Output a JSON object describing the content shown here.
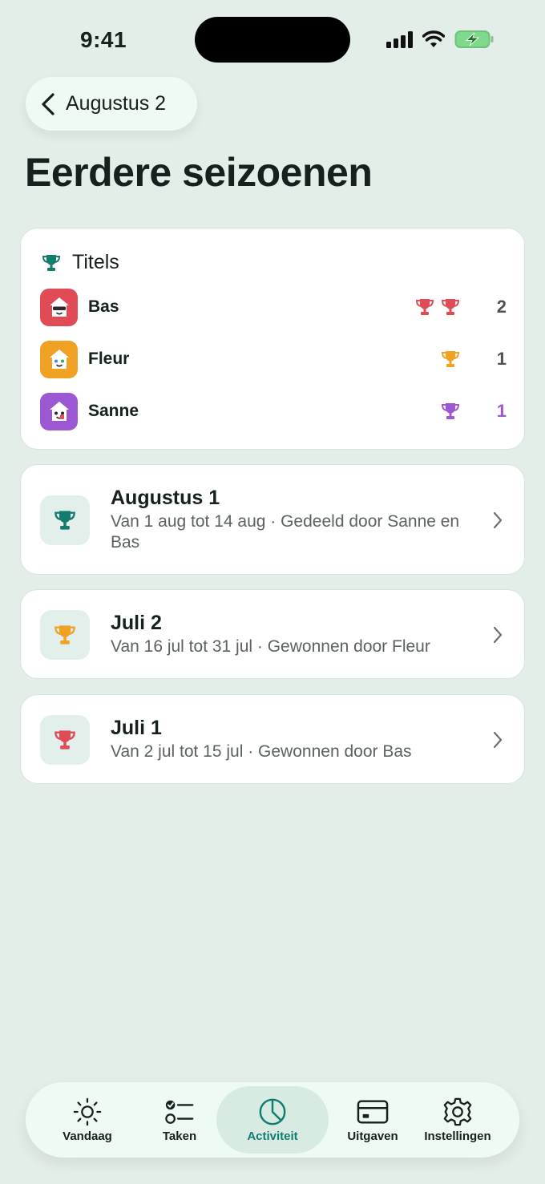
{
  "status_bar": {
    "time": "9:41"
  },
  "header": {
    "back_label": "Augustus 2",
    "title": "Eerdere seizoenen"
  },
  "titles": {
    "heading": "Titels",
    "players": [
      {
        "name": "Bas",
        "count": "2",
        "trophies": 2,
        "color": "#e04b55"
      },
      {
        "name": "Fleur",
        "count": "1",
        "trophies": 1,
        "color": "#f0a225"
      },
      {
        "name": "Sanne",
        "count": "1",
        "trophies": 1,
        "color": "#9b58d2"
      }
    ]
  },
  "seasons": [
    {
      "title": "Augustus 1",
      "subtitle": "Van 1 aug tot 14 aug · Gedeeld door Sanne en Bas",
      "trophy_color": "#137c6e"
    },
    {
      "title": "Juli 2",
      "subtitle": "Van 16 jul tot 31 jul · Gewonnen door Fleur",
      "trophy_color": "#f0a225"
    },
    {
      "title": "Juli 1",
      "subtitle": "Van 2 jul tot 15 jul · Gewonnen door Bas",
      "trophy_color": "#e04b55"
    }
  ],
  "tabs": [
    {
      "label": "Vandaag",
      "icon": "sun-icon"
    },
    {
      "label": "Taken",
      "icon": "checklist-icon"
    },
    {
      "label": "Activiteit",
      "icon": "pie-chart-icon",
      "active": true
    },
    {
      "label": "Uitgaven",
      "icon": "card-icon"
    },
    {
      "label": "Instellingen",
      "icon": "gear-icon"
    }
  ],
  "colors": {
    "background": "#e4eee9",
    "accent": "#137c6e",
    "bas": "#e04b55",
    "fleur": "#f0a225",
    "sanne": "#9b58d2"
  }
}
